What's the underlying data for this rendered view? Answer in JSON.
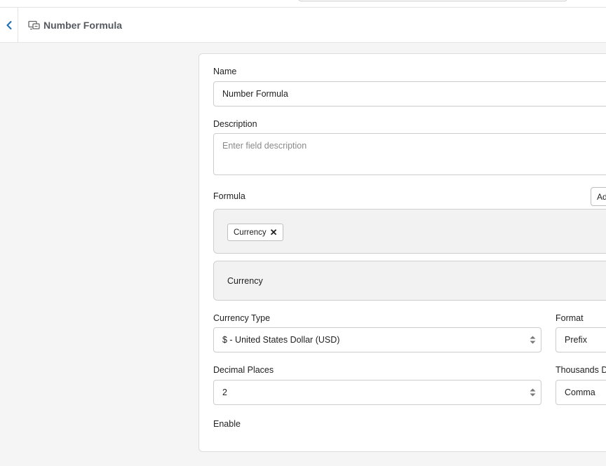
{
  "header": {
    "title": "Number Formula",
    "icon": "field-type-icon"
  },
  "form": {
    "name": {
      "label": "Name",
      "value": "Number Formula"
    },
    "description": {
      "label": "Description",
      "placeholder": "Enter field description"
    },
    "formula": {
      "label": "Formula",
      "add_button_label": "Ad",
      "chips": [
        {
          "label": "Currency"
        }
      ],
      "preview": "Currency"
    },
    "currency_type": {
      "label": "Currency Type",
      "value": "$ - United States Dollar (USD)"
    },
    "format": {
      "label": "Format",
      "value": "Prefix"
    },
    "decimal_places": {
      "label": "Decimal Places",
      "value": "2"
    },
    "thousands_separator": {
      "label": "Thousands D",
      "value": "Comma"
    },
    "enable": {
      "label": "Enable"
    }
  },
  "colors": {
    "accent": "#1a6fb5",
    "page_bg": "#f5f5f5",
    "formula_bg": "#f2f2f2"
  }
}
